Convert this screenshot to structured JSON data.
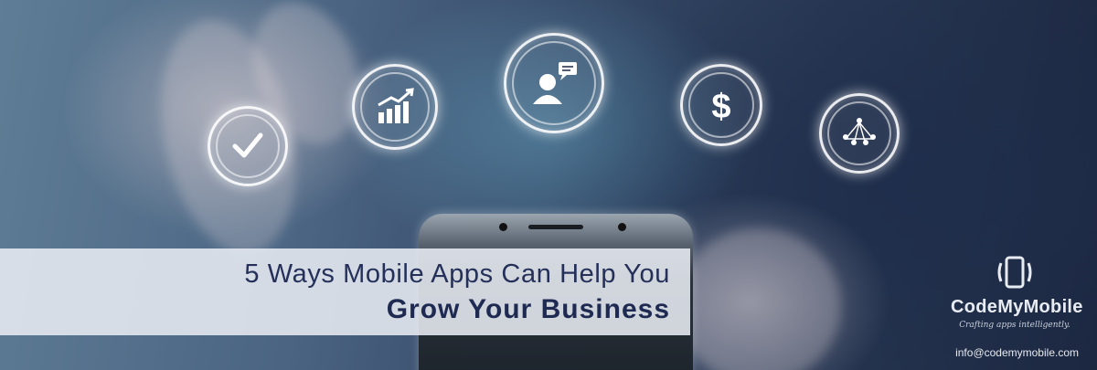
{
  "headline": {
    "line1": "5 Ways Mobile Apps Can Help You",
    "line2": "Grow Your Business"
  },
  "brand": {
    "name": "CodeMyMobile",
    "tagline": "Crafting apps intelligently.",
    "email": "info@codemymobile.com"
  },
  "icons": [
    "checkmark-icon",
    "growth-chart-icon",
    "user-chat-icon",
    "dollar-icon",
    "network-icon"
  ],
  "colors": {
    "title_text": "#24305a",
    "band": "#e8ecf3",
    "background_dark": "#1c2740",
    "icon_glow": "#ffffff"
  }
}
